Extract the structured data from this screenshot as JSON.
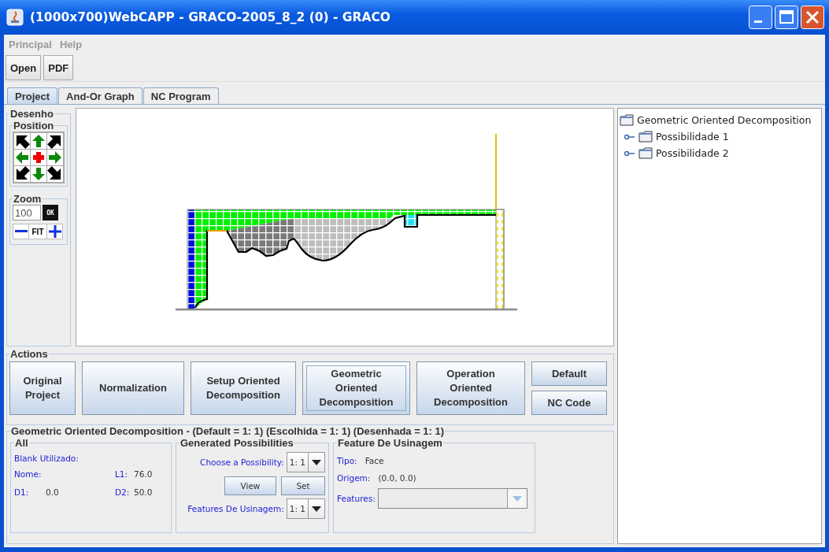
{
  "window": {
    "title": "(1000x700)WebCAPP - GRACO-2005_8_2 (0) - GRACO"
  },
  "menu": [
    {
      "label": "Principal",
      "disabled": true
    },
    {
      "label": "Help",
      "disabled": true
    }
  ],
  "toolbar": [
    "Open",
    "PDF"
  ],
  "tabs": [
    {
      "label": "Project",
      "selected": true
    },
    {
      "label": "And-Or Graph",
      "selected": false
    },
    {
      "label": "NC Program",
      "selected": false
    }
  ],
  "desenho": {
    "title": "Desenho",
    "position_title": "Position",
    "zoom_title": "Zoom",
    "zoom_value": "100",
    "ok_button": "OK",
    "fit_button": "FIT"
  },
  "actions": {
    "title": "Actions",
    "buttons": [
      {
        "label": "Original Project",
        "kind": "large",
        "selected": false
      },
      {
        "label": "Normalization",
        "kind": "large",
        "selected": false
      },
      {
        "label": "Setup Oriented Decomposition",
        "kind": "large",
        "selected": false
      },
      {
        "label": "Geometric Oriented Decomposition",
        "kind": "large",
        "selected": true
      },
      {
        "label": "Operation Oriented Decomposition",
        "kind": "large",
        "selected": false
      },
      {
        "label": "Default",
        "kind": "small",
        "selected": false
      },
      {
        "label": "NC Code",
        "kind": "small",
        "selected": false
      }
    ]
  },
  "details": {
    "title": "Geometric Oriented Decomposition - (Default = 1: 1) (Escolhida = 1: 1) (Desenhada = 1: 1)",
    "all": {
      "title": "All",
      "blank_label": "Blank Utilizado:",
      "rows": [
        {
          "label": "Nome:",
          "value_label": "L1:",
          "value": "76.0"
        },
        {
          "label": "D1:",
          "text": "0.0",
          "value_label": "D2:",
          "value": "50.0"
        }
      ]
    },
    "generated": {
      "title": "Generated Possibilities",
      "choose_label": "Choose a Possibility:",
      "choose_value": "1: 1",
      "view_button": "View",
      "set_button": "Set",
      "features_label": "Features De Usinagem:",
      "features_value": "1: 1"
    },
    "feature": {
      "title": "Feature De Usinagem",
      "tipo_label": "Tipo:",
      "tipo_value": "Face",
      "origem_label": "Origem:",
      "origem_value": "(0.0, 0.0)",
      "features_label": "Features:",
      "features_disabled": true
    }
  },
  "tree": {
    "label": "Geometric Oriented Decomposition",
    "children": [
      {
        "label": "Possibilidade 1",
        "expanded": false
      },
      {
        "label": "Possibilidade 2",
        "expanded": false
      }
    ]
  }
}
